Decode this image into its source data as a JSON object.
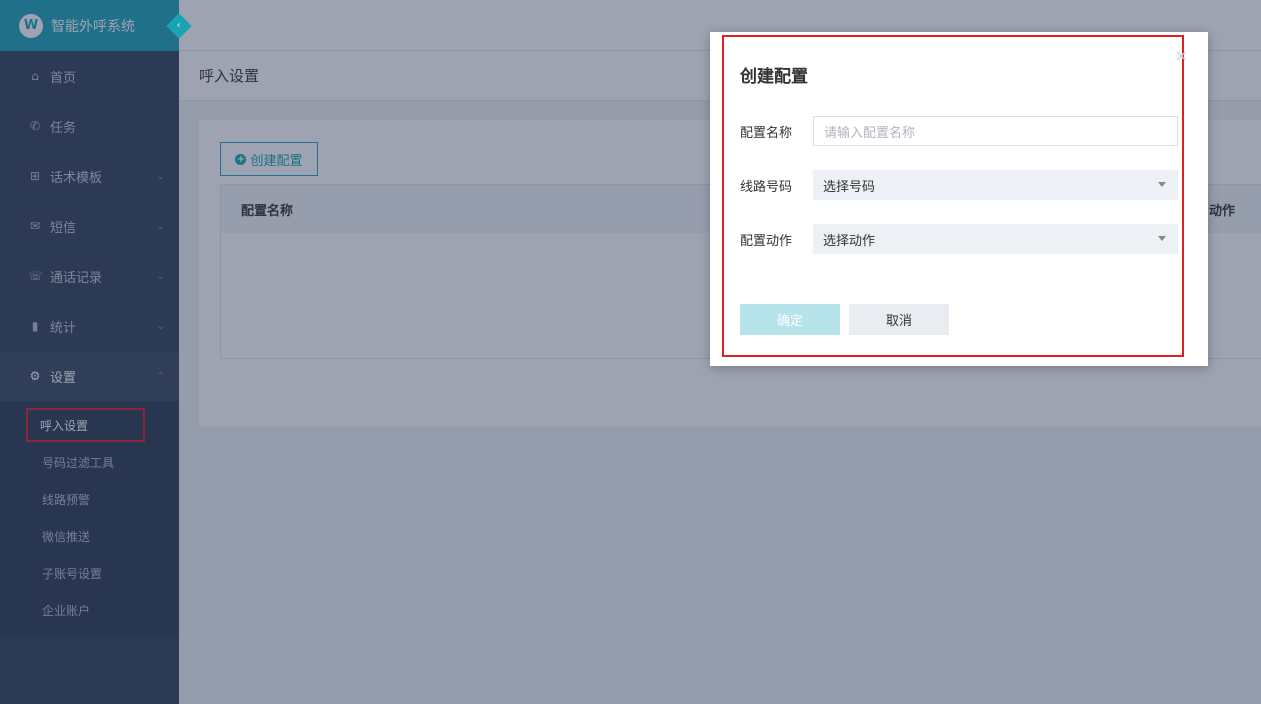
{
  "app": {
    "title": "智能外呼系统",
    "logo_glyph": "W"
  },
  "sidebar": {
    "items": [
      {
        "label": "首页",
        "icon": "home-icon"
      },
      {
        "label": "任务",
        "icon": "phone-icon"
      },
      {
        "label": "话术模板",
        "icon": "sitemap-icon"
      },
      {
        "label": "短信",
        "icon": "envelope-icon"
      },
      {
        "label": "通话记录",
        "icon": "call-log-icon"
      },
      {
        "label": "统计",
        "icon": "bar-chart-icon"
      },
      {
        "label": "设置",
        "icon": "gear-icon"
      }
    ],
    "sub_items": [
      {
        "label": "呼入设置"
      },
      {
        "label": "号码过滤工具"
      },
      {
        "label": "线路预警"
      },
      {
        "label": "微信推送"
      },
      {
        "label": "子账号设置"
      },
      {
        "label": "企业账户"
      }
    ]
  },
  "page": {
    "title": "呼入设置",
    "create_button": "创建配置",
    "table": {
      "col_name": "配置名称",
      "col_action": "动作"
    }
  },
  "modal": {
    "title": "创建配置",
    "close_glyph": "×",
    "fields": {
      "name_label": "配置名称",
      "name_placeholder": "请输入配置名称",
      "line_label": "线路号码",
      "line_value": "选择号码",
      "action_label": "配置动作",
      "action_value": "选择动作"
    },
    "ok_label": "确定",
    "cancel_label": "取消"
  },
  "colors": {
    "accent": "#1aa3b5",
    "sidebar": "#33405a",
    "highlight": "#e02020"
  }
}
